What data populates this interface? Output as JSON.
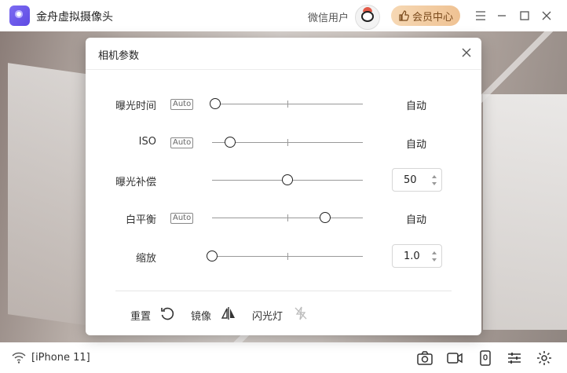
{
  "app": {
    "title": "金舟虚拟摄像头",
    "user_name": "微信用户",
    "vip_label": "会员中心"
  },
  "window_controls": [
    "menu-icon",
    "minimize-icon",
    "maximize-icon",
    "close-icon"
  ],
  "dialog": {
    "title": "相机参数",
    "rows": [
      {
        "label": "曝光时间",
        "auto_tag": "Auto",
        "value_text": "自动",
        "level": 0.02
      },
      {
        "label": "ISO",
        "auto_tag": "Auto",
        "value_text": "自动",
        "level": 0.12
      },
      {
        "label": "曝光补偿",
        "value": "50",
        "level": 0.5
      },
      {
        "label": "白平衡",
        "auto_tag": "Auto",
        "value_text": "自动",
        "level": 0.75
      },
      {
        "label": "缩放",
        "value": "1.0",
        "level": 0.0
      }
    ],
    "footer": {
      "reset": "重置",
      "mirror": "镜像",
      "flash": "闪光灯"
    }
  },
  "bottom": {
    "device": "[iPhone 11]"
  },
  "colors": {
    "vip_gradient_start": "#f6d8b4",
    "vip_text": "#7a4a1c",
    "accent": "#5e4ae3"
  }
}
